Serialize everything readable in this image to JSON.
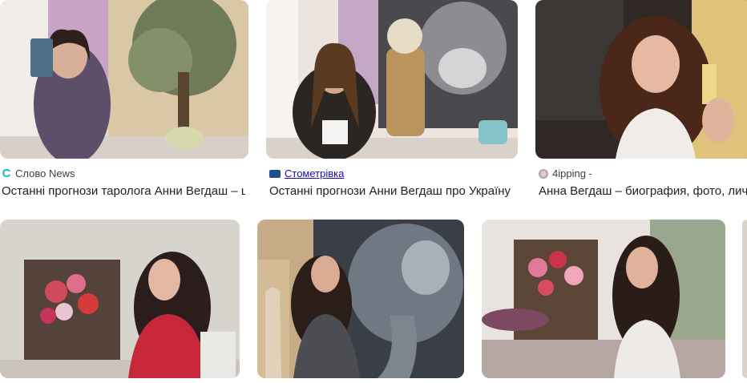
{
  "results": [
    {
      "source": "Слово News",
      "source_icon": "slovo-news-icon",
      "title": "Останні прогнози таролога Анни Вегдаш – що чекає Україну"
    },
    {
      "source": "Стометрівка",
      "source_icon": "stometrivka-icon",
      "title": "Останні прогнози Анни Вегдаш про Україну"
    },
    {
      "source": "4ipping -",
      "source_icon": "4ipping-icon",
      "title": "Анна Вегдаш – биография, фото, личная жизнь"
    }
  ],
  "colors": {
    "link": "#1a0dab",
    "text": "#202124",
    "meta": "#3c4043"
  }
}
